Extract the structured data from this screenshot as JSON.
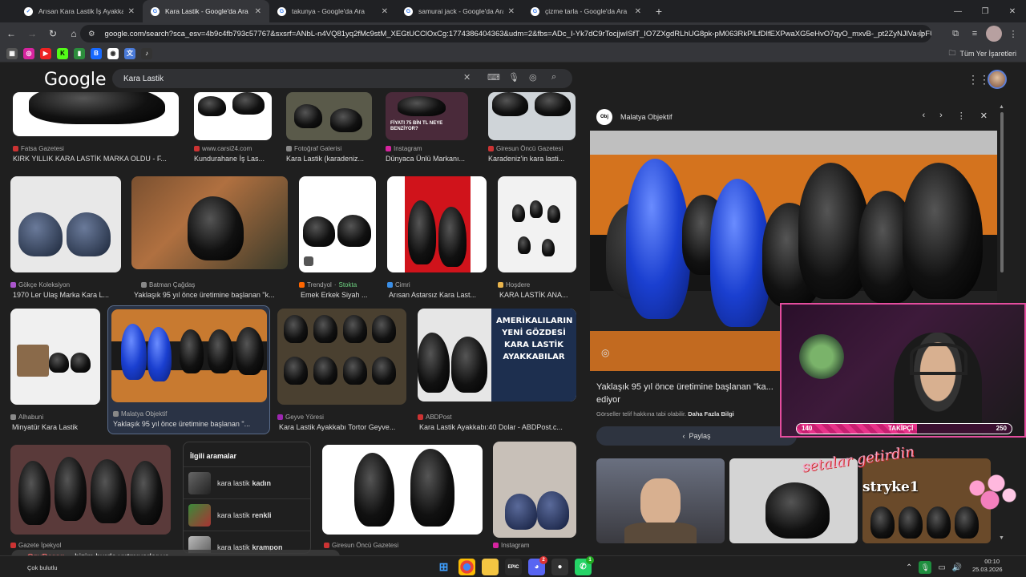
{
  "browser": {
    "tabs": [
      {
        "title": "Arısan Kara Lastik İş Ayakkabısı",
        "active": false
      },
      {
        "title": "Kara Lastik - Google'da Ara",
        "active": true
      },
      {
        "title": "takunya - Google'da Ara",
        "active": false
      },
      {
        "title": "samurai jack - Google'da Ara",
        "active": false
      },
      {
        "title": "çizme tarla - Google'da Ara",
        "active": false
      }
    ],
    "url": "google.com/search?sca_esv=4b9c4fb793c57767&sxsrf=ANbL-n4VQ81yq2fMc9stM_XEGtUCClOxCg:1774386404363&udm=2&fbs=ADc_I-Yk7dC9rTocjjwISfT_IO7ZXgdRLhUG8pk-pM063RkPlLfDIfEXPwaXG5eHvO7qyO_mxvB-_pt2ZyNJlVa-ipFUKT...",
    "bookmarks_folder": "Tüm Yer İşaretleri"
  },
  "google": {
    "logo": "Google",
    "query": "Kara Lastik"
  },
  "results": {
    "row1": [
      {
        "source": "Fatsa Gazetesi",
        "title": "KIRK YILLIK KARA LASTİK MARKA OLDU - F..."
      },
      {
        "source": "www.carsi24.com",
        "title": "Kundurahane İş Las..."
      },
      {
        "source": "Fotoğraf Galerisi",
        "title": "Kara Lastik (karadeniz..."
      },
      {
        "source": "Instagram",
        "title": "Dünyaca Ünlü Markanı..."
      },
      {
        "source": "Giresun Öncü Gazetesi",
        "title": "Karadeniz'in kara lasti..."
      }
    ],
    "row2": [
      {
        "source": "Gökçe Koleksiyon",
        "title": "1970 Ler Ulaş Marka Kara L..."
      },
      {
        "source": "Batman Çağdaş",
        "title": "Yaklaşık 95 yıl önce üretimine başlanan \"k..."
      },
      {
        "source": "Trendyol",
        "stock": "Stokta",
        "title": "Emek Erkek Siyah ..."
      },
      {
        "source": "Cimri",
        "title": "Arısan Astarsız Kara Last..."
      },
      {
        "source": "Hoşdere",
        "title": "KARA LASTİK ANA..."
      }
    ],
    "row3": [
      {
        "source": "Alhabuni",
        "title": "Minyatür Kara Lastik"
      },
      {
        "source": "Malatya Objektif",
        "title": "Yaklaşık 95 yıl önce üretimine başlanan \"..."
      },
      {
        "source": "Geyve Yöresi",
        "title": "Kara Lastik Ayakkabı Tortor Geyve..."
      },
      {
        "source": "ABDPost",
        "title": "Kara Lastik Ayakkabı:40 Dolar - ABDPost.c..."
      }
    ],
    "row3_ad_text": "AMERİKALILARIN YENİ GÖZDESİ KARA LASTİK AYAKKABILAR",
    "row4": [
      {
        "source": "Gazete İpekyol"
      },
      {
        "source": "Giresun Öncü Gazetesi"
      },
      {
        "source": "Instagram"
      }
    ],
    "instagram_overlay": "FİYATI 75 BİN TL NEYE BENZİYOR?"
  },
  "related": {
    "heading": "İlgili aramalar",
    "items": [
      {
        "prefix": "kara lastik",
        "bold": "kadın"
      },
      {
        "prefix": "kara lastik",
        "bold": "renkli"
      },
      {
        "prefix": "kara lastik",
        "bold": "krampon"
      }
    ]
  },
  "preview": {
    "source": "Malatya Objektif",
    "title": "Yaklaşık 95 yıl önce üretimine başlanan \"ka...",
    "title_line2": "ediyor",
    "rights": "Görseller telif hakkına tabi olabilir.",
    "more_info": "Daha Fazla Bilgi",
    "share": "Paylaş"
  },
  "stream": {
    "follow_label": "TAKİPÇİ",
    "follow_current": 140,
    "follow_goal": 250,
    "follow_progress": 0.56,
    "gift_text": "setalar getirdin",
    "donor": "stryke1",
    "chat_user": "OzyBaron",
    "chat_message": "bizim burda yırtmıyorlar ya"
  },
  "taskbar": {
    "weather": "Çok bulutlu",
    "discord_badge": "2",
    "whatsapp_badge": "1",
    "time": "00:10",
    "date": "25.03.2026"
  },
  "colors": {
    "accent_pink": "#e8338a",
    "selected_card": "#2a3345",
    "google_bg": "#1f1f1f"
  }
}
